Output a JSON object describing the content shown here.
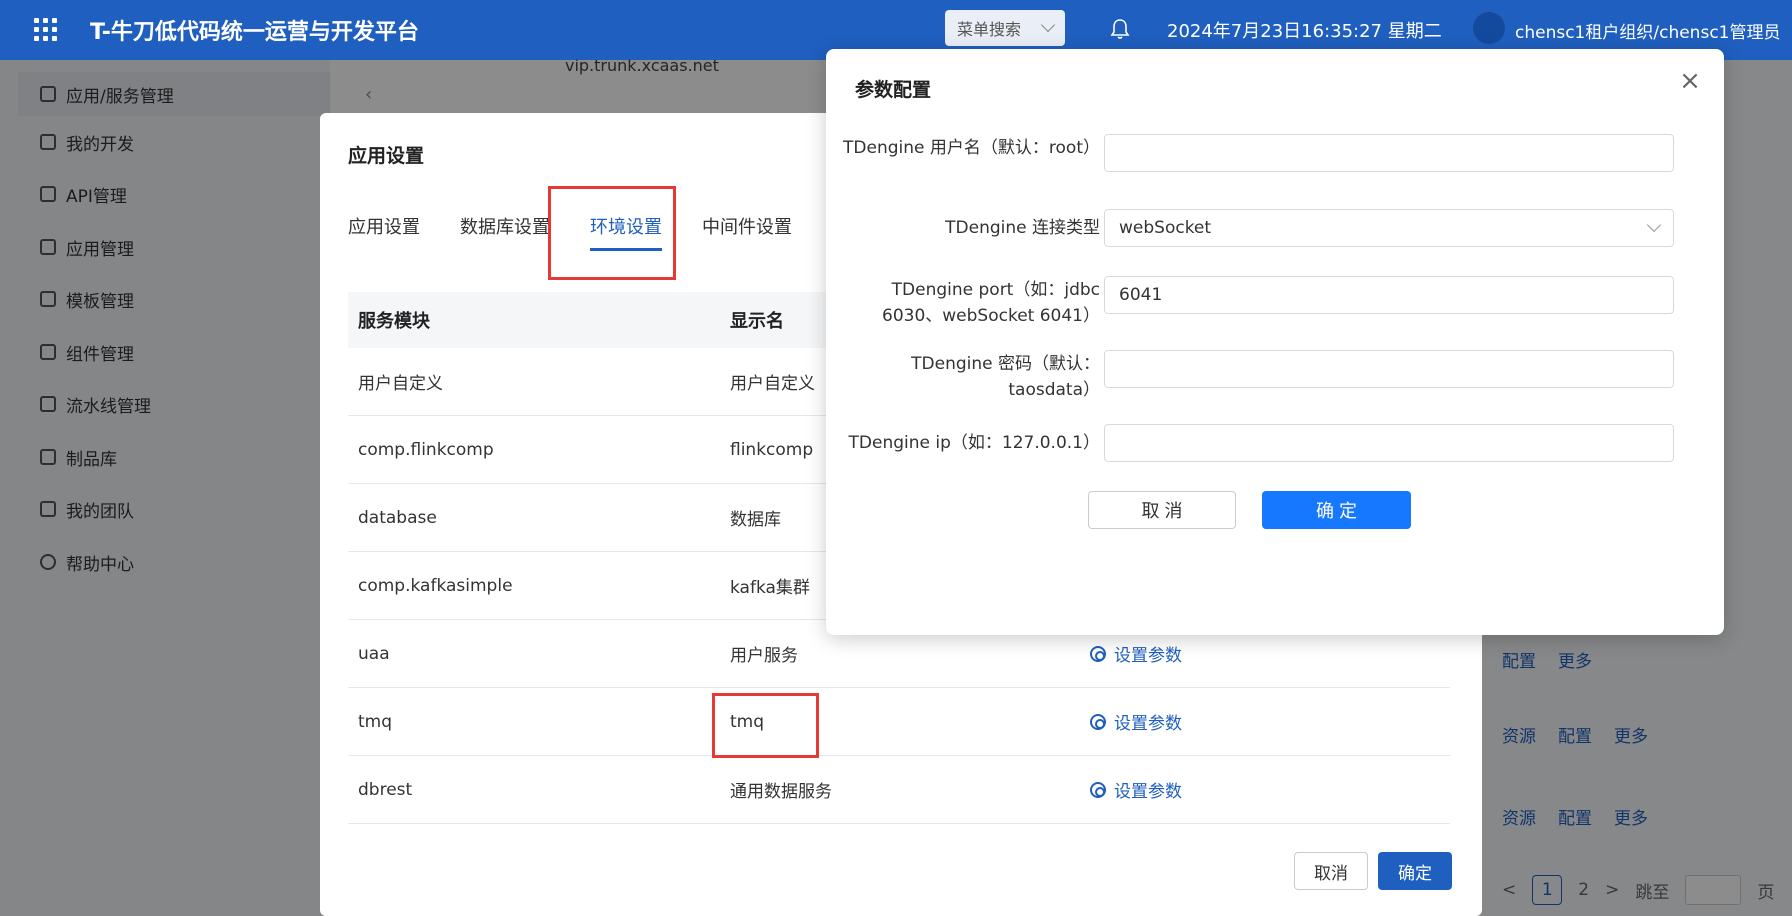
{
  "header": {
    "app_title": "T-牛刀低代码统一运营与开发平台",
    "menu_search": "菜单搜索",
    "datetime": "2024年7月23日16:35:27 星期二",
    "user": "chensc1租户组织/chensc1管理员"
  },
  "sidebar": {
    "items": [
      {
        "label": "应用/服务管理",
        "icon": "app-service-icon"
      },
      {
        "label": "我的开发",
        "icon": "dev-icon"
      },
      {
        "label": "API管理",
        "icon": "api-icon"
      },
      {
        "label": "应用管理",
        "icon": "grid-icon"
      },
      {
        "label": "模板管理",
        "icon": "template-icon"
      },
      {
        "label": "组件管理",
        "icon": "component-icon"
      },
      {
        "label": "流水线管理",
        "icon": "folder-icon"
      },
      {
        "label": "制品库",
        "icon": "folder-icon"
      },
      {
        "label": "我的团队",
        "icon": "team-icon"
      },
      {
        "label": "帮助中心",
        "icon": "help-icon"
      }
    ]
  },
  "background": {
    "domain": "vip.trunk.xcaas.net"
  },
  "app_settings_dialog": {
    "title": "应用设置",
    "tabs": [
      "应用设置",
      "数据库设置",
      "环境设置",
      "中间件设置"
    ],
    "active_tab": "环境设置",
    "columns": [
      "服务模块",
      "显示名"
    ],
    "rows": [
      {
        "module": "用户自定义",
        "display": "用户自定义",
        "action": ""
      },
      {
        "module": "comp.flinkcomp",
        "display": "flinkcomp",
        "action": ""
      },
      {
        "module": "database",
        "display": "数据库",
        "action": ""
      },
      {
        "module": "comp.kafkasimple",
        "display": "kafka集群",
        "action": ""
      },
      {
        "module": "uaa",
        "display": "用户服务",
        "action": "设置参数"
      },
      {
        "module": "tmq",
        "display": "tmq",
        "action": "设置参数"
      },
      {
        "module": "dbrest",
        "display": "通用数据服务",
        "action": "设置参数"
      }
    ],
    "cancel": "取消",
    "ok": "确定"
  },
  "right_panel": {
    "rows": [
      [
        "配置",
        "更多"
      ],
      [
        "资源",
        "配置",
        "更多"
      ],
      [
        "资源",
        "配置",
        "更多"
      ]
    ],
    "pager": {
      "prev": "<",
      "current": "1",
      "next_page": "2",
      "next": ">",
      "jump": "跳至",
      "page": "页"
    }
  },
  "param_dialog": {
    "title": "参数配置",
    "fields": [
      {
        "label": "TDengine 用户名（默认：root）",
        "value": ""
      },
      {
        "label": "TDengine 连接类型",
        "value": "webSocket"
      },
      {
        "label": "TDengine port（如：jdbc 6030、webSocket 6041）",
        "value": "6041"
      },
      {
        "label": "TDengine 密码（默认：taosdata）",
        "value": ""
      },
      {
        "label": "TDengine ip（如：127.0.0.1）",
        "value": ""
      }
    ],
    "cancel": "取 消",
    "ok": "确 定"
  },
  "colors": {
    "primary": "#1f5fbf",
    "ok_button": "#1677ff",
    "highlight": "#e53935"
  }
}
